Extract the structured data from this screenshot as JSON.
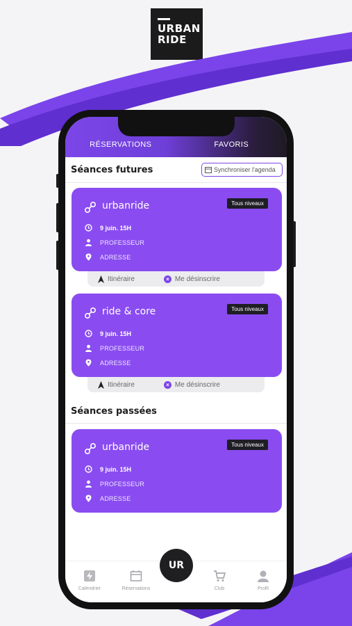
{
  "logo": {
    "line1": "URBAN",
    "line2": "RIDE"
  },
  "tabs": [
    {
      "label": "RÉSERVATIONS",
      "active": true
    },
    {
      "label": "FAVORIS",
      "active": false
    }
  ],
  "future": {
    "heading": "Séances futures",
    "sync_label": "Synchroniser l'agenda"
  },
  "past": {
    "heading": "Séances passées"
  },
  "cards": [
    {
      "title": "urbanride",
      "badge": "Tous niveaux",
      "date": "9 juin. 15H",
      "teacher": "PROFESSEUR",
      "address": "ADRESSE"
    },
    {
      "title": "ride & core",
      "badge": "Tous niveaux",
      "date": "9 juin. 15H",
      "teacher": "PROFESSEUR",
      "address": "ADRESSE"
    },
    {
      "title": "urbanride",
      "badge": "Tous niveaux",
      "date": "9 juin. 15H",
      "teacher": "PROFESSEUR",
      "address": "ADRESSE"
    }
  ],
  "actions": {
    "itinerary": "Itinéraire",
    "unsubscribe": "Me désinscrire"
  },
  "bottom_nav": {
    "calendar": "Calendrier",
    "reservations": "Réservations",
    "center": "UR",
    "club": "Club",
    "profile": "Profil"
  },
  "colors": {
    "accent": "#8a4cf0",
    "dark": "#1f1f22"
  }
}
